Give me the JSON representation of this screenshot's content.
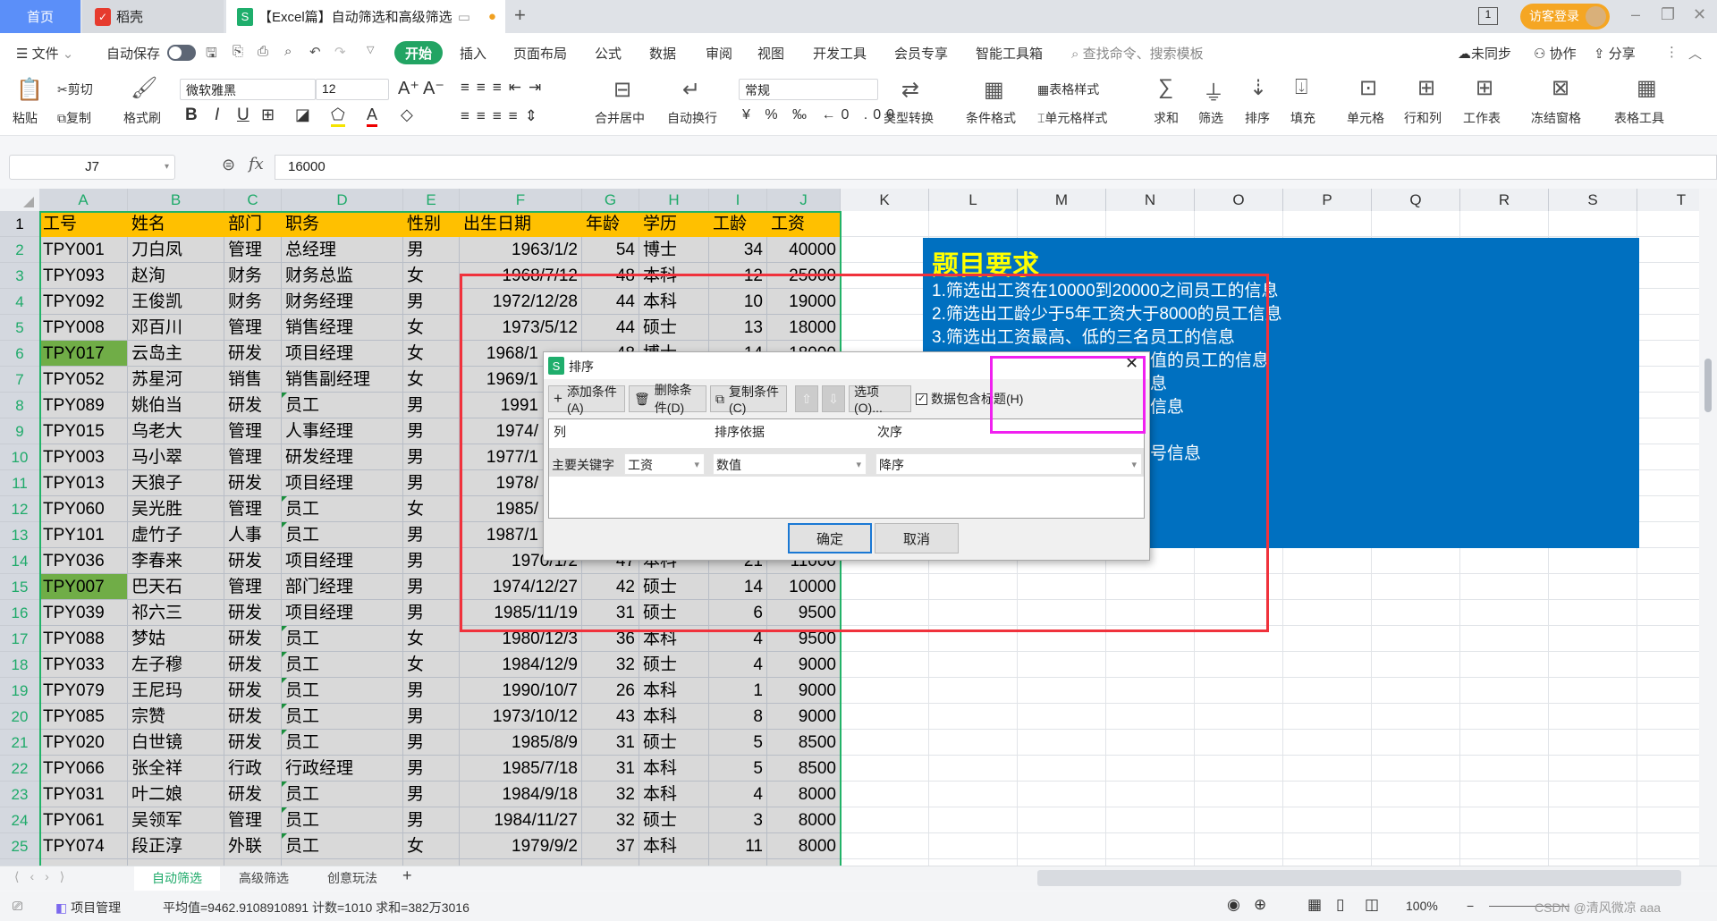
{
  "tabs": {
    "home": "首页",
    "daoke": "稻壳",
    "doc": "【Excel篇】自动筛选和高级筛选",
    "add": "+"
  },
  "window": {
    "login": "访客登录",
    "min": "–",
    "restore": "❐",
    "close": "✕",
    "page_ind": "1"
  },
  "menu": {
    "file": "文件",
    "autosave": "自动保存",
    "items": [
      "开始",
      "插入",
      "页面布局",
      "公式",
      "数据",
      "审阅",
      "视图",
      "开发工具",
      "会员专享",
      "智能工具箱"
    ],
    "search_placeholder": "查找命令、搜索模板",
    "sync": "未同步",
    "collab": "协作",
    "share": "分享"
  },
  "ribbon": {
    "paste": "粘贴",
    "cut": "剪切",
    "copy": "复制",
    "format_painter": "格式刷",
    "font": "微软雅黑",
    "font_size": "12",
    "merge": "合并居中",
    "wrap": "自动换行",
    "number_format": "常规",
    "type_convert": "类型转换",
    "cond_format": "条件格式",
    "table_style": "表格样式",
    "cell_style": "单元格样式",
    "sum": "求和",
    "filter": "筛选",
    "sort": "排序",
    "fill": "填充",
    "cell": "单元格",
    "rowcol": "行和列",
    "sheet": "工作表",
    "freeze": "冻结窗格",
    "table_tools": "表格工具"
  },
  "formula_bar": {
    "name_box": "J7",
    "fx": "fx",
    "value": "16000"
  },
  "columns": [
    "A",
    "B",
    "C",
    "D",
    "E",
    "F",
    "G",
    "H",
    "I",
    "J",
    "K",
    "L",
    "M",
    "N",
    "O",
    "P",
    "Q",
    "R",
    "S",
    "T"
  ],
  "header_row": [
    "工号",
    "姓名",
    "部门",
    "职务",
    "性别",
    "出生日期",
    "年龄",
    "学历",
    "工龄",
    "工资"
  ],
  "rows": [
    [
      "TPY001",
      "刀白凤",
      "管理",
      "总经理",
      "男",
      "1963/1/2",
      "54",
      "博士",
      "34",
      "40000"
    ],
    [
      "TPY093",
      "赵洵",
      "财务",
      "财务总监",
      "女",
      "1968/7/12",
      "48",
      "本科",
      "12",
      "25000"
    ],
    [
      "TPY092",
      "王俊凯",
      "财务",
      "财务经理",
      "男",
      "1972/12/28",
      "44",
      "本科",
      "10",
      "19000"
    ],
    [
      "TPY008",
      "邓百川",
      "管理",
      "销售经理",
      "女",
      "1973/5/12",
      "44",
      "硕士",
      "13",
      "18000"
    ],
    [
      "TPY017",
      "云岛主",
      "研发",
      "项目经理",
      "女",
      "1968/1",
      "48",
      "博士",
      "14",
      "18000"
    ],
    [
      "TPY052",
      "苏星河",
      "销售",
      "销售副经理",
      "女",
      "1969/1",
      "",
      "",
      "",
      ""
    ],
    [
      "TPY089",
      "姚伯当",
      "研发",
      "员工",
      "男",
      "1991",
      "",
      "",
      "",
      ""
    ],
    [
      "TPY015",
      "乌老大",
      "管理",
      "人事经理",
      "男",
      "1974/",
      "",
      "",
      "",
      ""
    ],
    [
      "TPY003",
      "马小翠",
      "管理",
      "研发经理",
      "男",
      "1977/1",
      "",
      "",
      "",
      ""
    ],
    [
      "TPY013",
      "天狼子",
      "研发",
      "项目经理",
      "男",
      "1978/",
      "",
      "",
      "",
      ""
    ],
    [
      "TPY060",
      "吴光胜",
      "管理",
      "员工",
      "女",
      "1985/",
      "",
      "",
      "",
      ""
    ],
    [
      "TPY101",
      "虚竹子",
      "人事",
      "员工",
      "男",
      "1987/1",
      "",
      "",
      "",
      ""
    ],
    [
      "TPY036",
      "李春来",
      "研发",
      "项目经理",
      "男",
      "1970/1/2",
      "47",
      "本科",
      "21",
      "11000"
    ],
    [
      "TPY007",
      "巴天石",
      "管理",
      "部门经理",
      "男",
      "1974/12/27",
      "42",
      "硕士",
      "14",
      "10000"
    ],
    [
      "TPY039",
      "祁六三",
      "研发",
      "项目经理",
      "男",
      "1985/11/19",
      "31",
      "硕士",
      "6",
      "9500"
    ],
    [
      "TPY088",
      "梦姑",
      "研发",
      "员工",
      "女",
      "1980/12/3",
      "36",
      "本科",
      "4",
      "9500"
    ],
    [
      "TPY033",
      "左子穆",
      "研发",
      "员工",
      "女",
      "1984/12/9",
      "32",
      "硕士",
      "4",
      "9000"
    ],
    [
      "TPY079",
      "王尼玛",
      "研发",
      "员工",
      "男",
      "1990/10/7",
      "26",
      "本科",
      "1",
      "9000"
    ],
    [
      "TPY085",
      "宗赞",
      "研发",
      "员工",
      "男",
      "1973/10/12",
      "43",
      "本科",
      "8",
      "9000"
    ],
    [
      "TPY020",
      "白世镜",
      "研发",
      "员工",
      "男",
      "1985/8/9",
      "31",
      "硕士",
      "5",
      "8500"
    ],
    [
      "TPY066",
      "张全祥",
      "行政",
      "行政经理",
      "男",
      "1985/7/18",
      "31",
      "本科",
      "5",
      "8500"
    ],
    [
      "TPY031",
      "叶二娘",
      "研发",
      "员工",
      "男",
      "1984/9/18",
      "32",
      "本科",
      "4",
      "8000"
    ],
    [
      "TPY061",
      "吴领军",
      "管理",
      "员工",
      "男",
      "1984/11/27",
      "32",
      "硕士",
      "3",
      "8000"
    ],
    [
      "TPY074",
      "段正淳",
      "外联",
      "员工",
      "女",
      "1979/9/2",
      "37",
      "本科",
      "11",
      "8000"
    ]
  ],
  "highlight_color": "#70ad47",
  "panel": {
    "title": "题目要求",
    "lines": [
      "1.筛选出工资在10000到20000之间员工的信息",
      "2.筛选出工龄少于5年工资大于8000的员工信息",
      "3.筛选出工资最高、低的三名员工的信息"
    ],
    "fragments": [
      "值的员工的信息",
      "息",
      "信息",
      "号信息"
    ]
  },
  "dialog": {
    "title": "排序",
    "add": "添加条件(A)",
    "delete": "删除条件(D)",
    "copy": "复制条件(C)",
    "options": "选项(O)...",
    "has_header": "数据包含标题(H)",
    "has_header_checked": true,
    "col_header": "列",
    "basis_header": "排序依据",
    "order_header": "次序",
    "row_label": "主要关键字",
    "column": "工资",
    "basis": "数值",
    "order": "降序",
    "ok": "确定",
    "cancel": "取消"
  },
  "sheets": {
    "tabs": [
      "自动筛选",
      "高级筛选",
      "创意玩法"
    ],
    "active": 0,
    "add": "+"
  },
  "status": {
    "project": "项目管理",
    "stats": "平均值=9462.9108910891  计数=1010  求和=382万3016",
    "zoom": "100%",
    "watermark": "CSDN @清风微凉 aaa"
  }
}
